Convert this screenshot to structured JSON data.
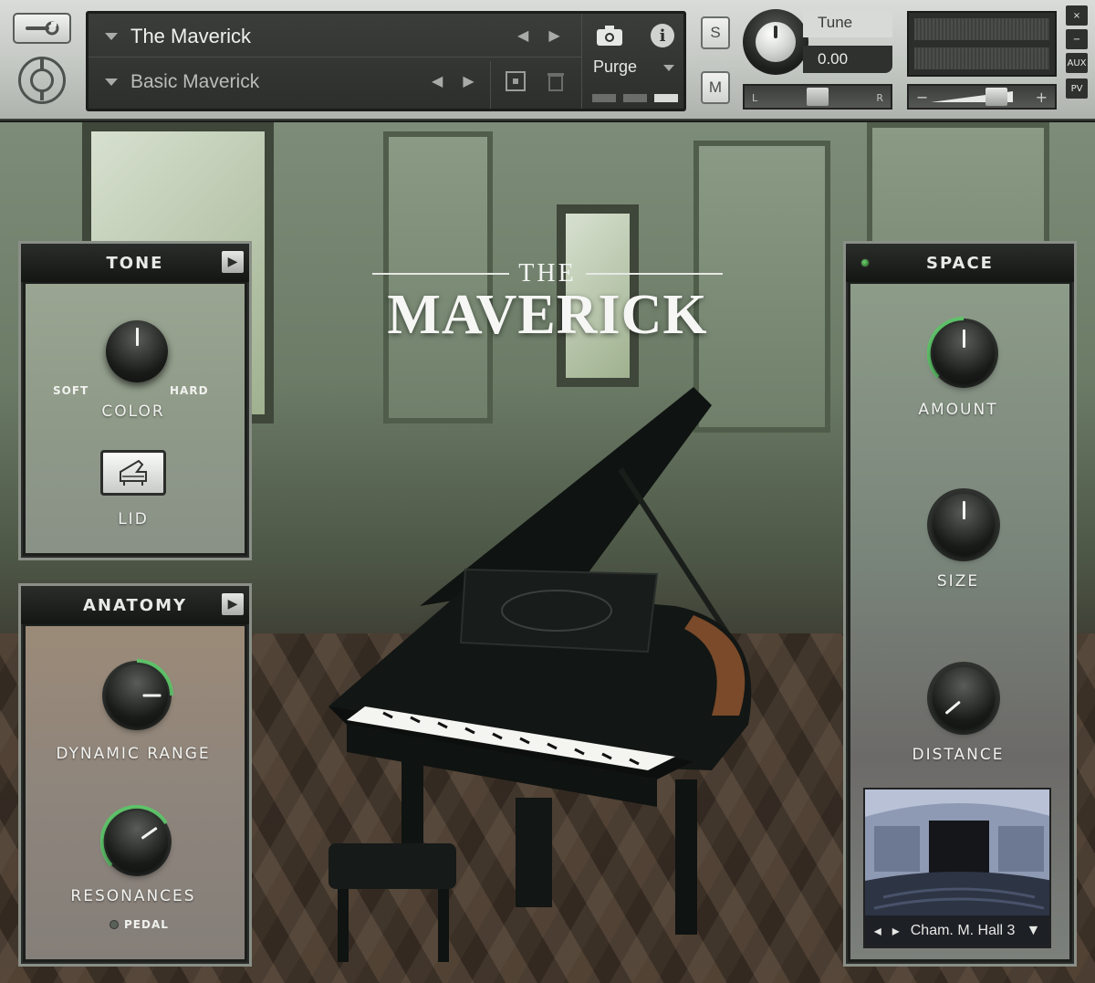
{
  "header": {
    "instrument_name": "The Maverick",
    "preset_name": "Basic Maverick",
    "purge_label": "Purge",
    "solo_label": "S",
    "mute_label": "M",
    "tune_label": "Tune",
    "tune_value": "0.00",
    "pan_left": "L",
    "pan_right": "R",
    "vol_minus": "−",
    "vol_plus": "+",
    "side_close": "×",
    "side_minimize": "−",
    "side_aux": "AUX",
    "side_pv": "PV"
  },
  "title": {
    "the": "THE",
    "main": "MAVERICK"
  },
  "tone": {
    "title": "TONE",
    "soft": "SOFT",
    "hard": "HARD",
    "color_label": "COLOR",
    "lid_label": "LID"
  },
  "anatomy": {
    "title": "ANATOMY",
    "dynamic_range_label": "DYNAMIC RANGE",
    "resonances_label": "RESONANCES",
    "pedal_label": "PEDAL"
  },
  "space": {
    "title": "SPACE",
    "amount_label": "AMOUNT",
    "size_label": "SIZE",
    "distance_label": "DISTANCE",
    "room_name": "Cham. M. Hall 3"
  },
  "colors": {
    "knob_arc": "#5fc36a",
    "panel_border": "#8a8f87"
  }
}
